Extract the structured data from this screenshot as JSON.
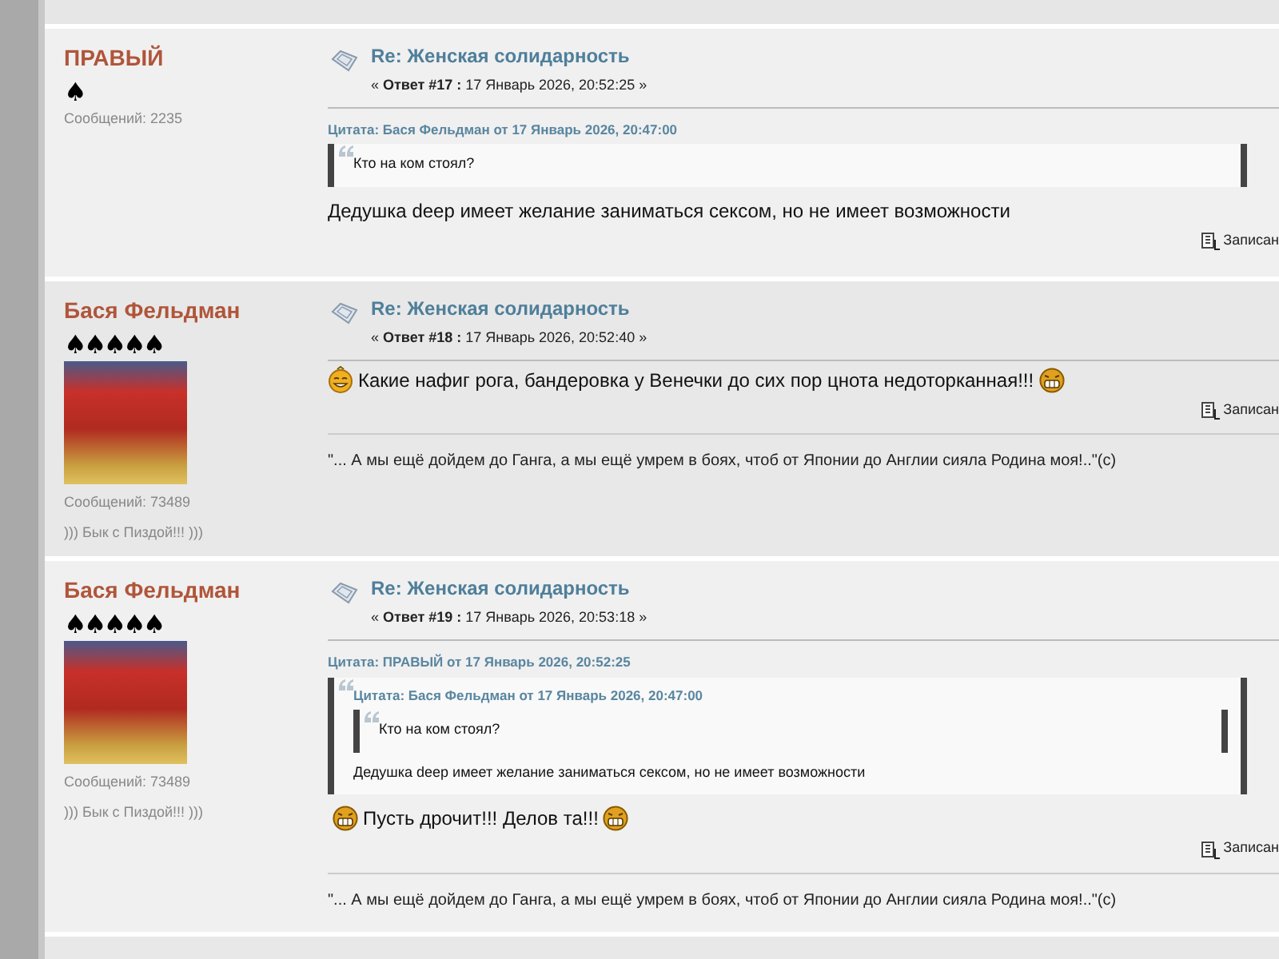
{
  "posts": [
    {
      "author": "ПРАВЫЙ",
      "rank": "♠",
      "avatar": false,
      "post_count": "Сообщений: 2235",
      "title": "Re: Женская солидарность",
      "meta": "« **Ответ #17 :** 17 Январь 2026, 20:52:25 »",
      "body": [
        {
          "kind": "quote",
          "header": "Цитата: Бася Фельдман от 17 Январь 2026, 20:47:00",
          "body": [
            {
              "kind": "text",
              "text": "Кто на ком стоял?"
            }
          ]
        },
        {
          "kind": "message",
          "parts": [
            {
              "kind": "text",
              "text": "Дедушка deep имеет желание заниматься сексом, но не имеет возможности"
            }
          ]
        }
      ],
      "save_label": "Записан"
    },
    {
      "author": "Бася Фельдман",
      "rank": "♠♠♠♠♠",
      "avatar": true,
      "post_count": "Сообщений: 73489",
      "personal_text": "))) Бык с Пиздой!!! )))",
      "title": "Re: Женская солидарность",
      "meta": "« **Ответ #18 :** 17 Январь 2026, 20:52:40 »",
      "body": [
        {
          "kind": "message",
          "parts": [
            {
              "kind": "laughing_smiley"
            },
            {
              "kind": "text",
              "text": "Какие нафиг рога, бандеровка у Венечки до сих пор цнота недоторканная!!!"
            },
            {
              "kind": "grinning_smiley"
            }
          ]
        }
      ],
      "save_label": "Записан",
      "signature": "\"... А мы ещё дойдем до Ганга, а мы ещё умрем в боях, чтоб от Японии до Англии сияла Родина моя!..\"(c)"
    },
    {
      "author": "Бася Фельдман",
      "rank": "♠♠♠♠♠",
      "avatar": true,
      "post_count": "Сообщений: 73489",
      "personal_text": "))) Бык с Пиздой!!! )))",
      "title": "Re: Женская солидарность",
      "meta": "« **Ответ #19 :** 17 Январь 2026, 20:53:18 »",
      "body": [
        {
          "kind": "quote",
          "header": "Цитата: ПРАВЫЙ от 17 Январь 2026, 20:52:25",
          "body": [
            {
              "kind": "quote",
              "header": "Цитата: Бася Фельдман от 17 Январь 2026, 20:47:00",
              "body": [
                {
                  "kind": "text",
                  "text": "Кто на ком стоял?"
                }
              ]
            },
            {
              "kind": "text",
              "text": "Дедушка deep имеет желание заниматься сексом, но не имеет возможности"
            }
          ]
        },
        {
          "kind": "message",
          "parts": [
            {
              "kind": "grinning_smiley"
            },
            {
              "kind": "text",
              "text": "Пусть дрочит!!! Делов та!!!"
            },
            {
              "kind": "grinning_smiley"
            }
          ]
        }
      ],
      "save_label": "Записан",
      "signature": "\"... А мы ещё дойдем до Ганга, а мы ещё умрем в боях, чтоб от Японии до Англии сияла Родина моя!..\"(c)"
    }
  ]
}
